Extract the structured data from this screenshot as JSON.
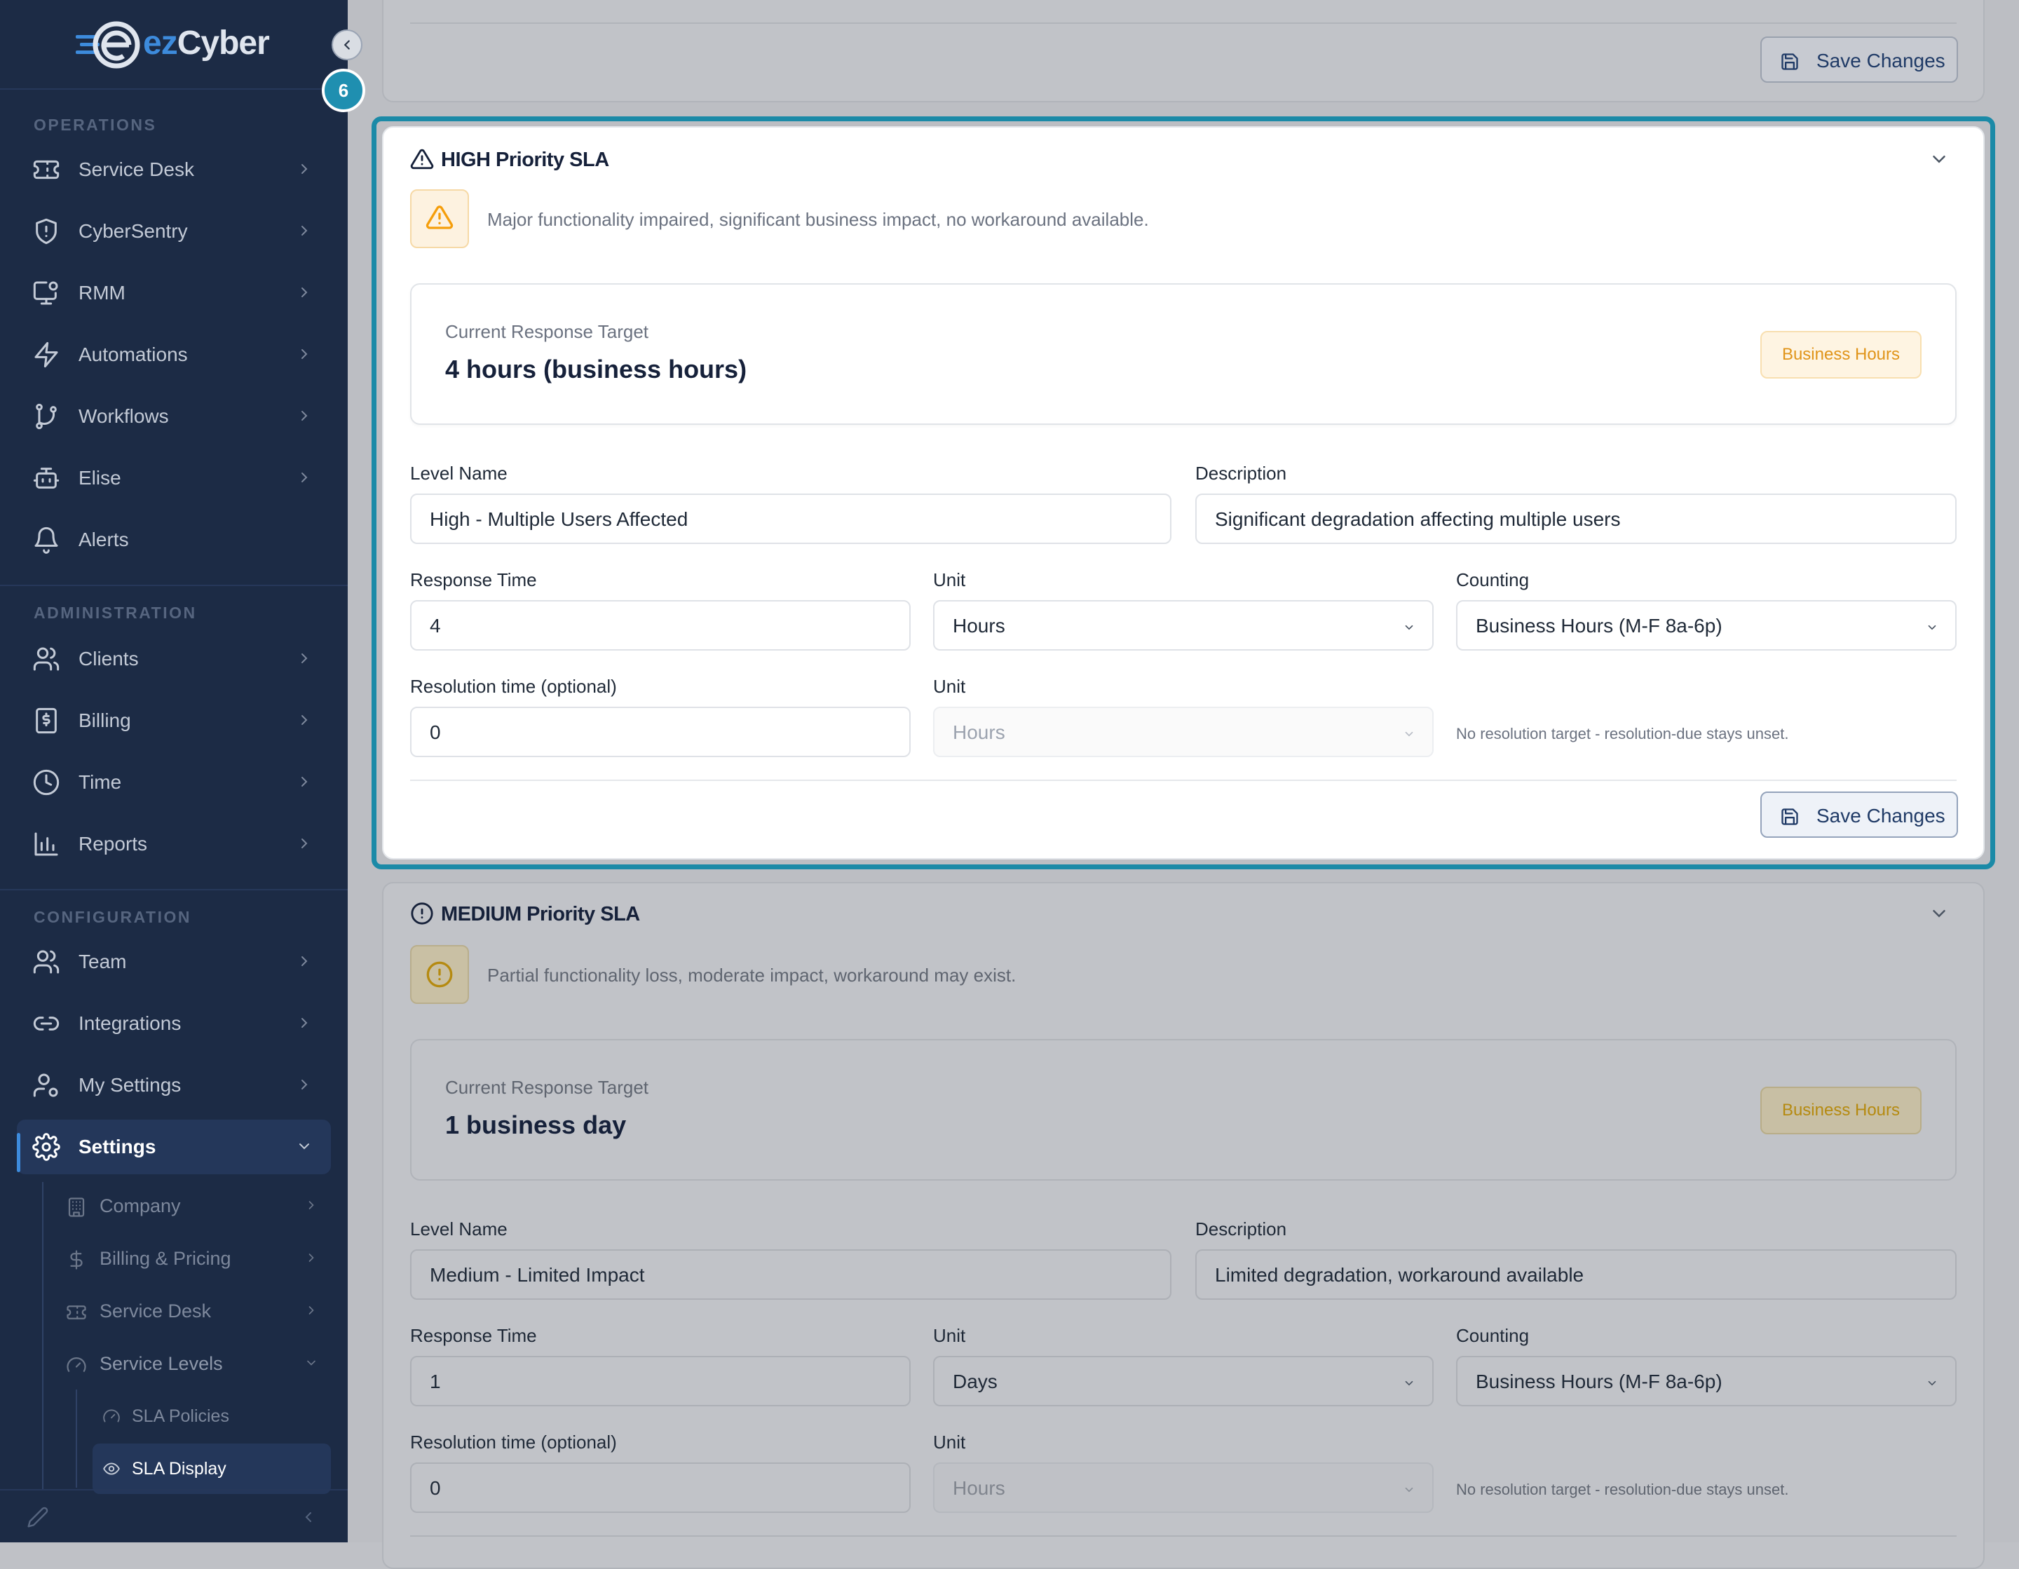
{
  "brand": {
    "prefix": "ez",
    "name": "Cyber"
  },
  "step_badge": "6",
  "sidebar": {
    "sections": [
      {
        "title": "OPERATIONS",
        "items": [
          {
            "label": "Service Desk"
          },
          {
            "label": "CyberSentry"
          },
          {
            "label": "RMM"
          },
          {
            "label": "Automations"
          },
          {
            "label": "Workflows"
          },
          {
            "label": "Elise"
          },
          {
            "label": "Alerts"
          }
        ]
      },
      {
        "title": "ADMINISTRATION",
        "items": [
          {
            "label": "Clients"
          },
          {
            "label": "Billing"
          },
          {
            "label": "Time"
          },
          {
            "label": "Reports"
          }
        ]
      },
      {
        "title": "CONFIGURATION",
        "items": [
          {
            "label": "Team"
          },
          {
            "label": "Integrations"
          },
          {
            "label": "My Settings"
          },
          {
            "label": "Settings"
          }
        ]
      }
    ],
    "settings_children": [
      {
        "label": "Company"
      },
      {
        "label": "Billing & Pricing"
      },
      {
        "label": "Service Desk"
      },
      {
        "label": "Service Levels"
      }
    ],
    "service_levels_children": [
      {
        "label": "SLA Policies"
      },
      {
        "label": "SLA Display"
      }
    ]
  },
  "colors": {
    "accent": "#1b8aa7",
    "sidebar_bg": "#1c2b45",
    "high_warn": "#f59e0b",
    "medium_warn": "#d4a017"
  },
  "top_card": {
    "save_label": "Save Changes"
  },
  "high_sla": {
    "title": "HIGH Priority SLA",
    "description": "Major functionality impaired, significant business impact, no workaround available.",
    "target_label": "Current Response Target",
    "target_value": "4 hours (business hours)",
    "badge": "Business Hours",
    "level_name_label": "Level Name",
    "level_name": "High - Multiple Users Affected",
    "description_label": "Description",
    "description_value": "Significant degradation affecting multiple users",
    "response_time_label": "Response Time",
    "response_time": "4",
    "unit_label": "Unit",
    "unit": "Hours",
    "counting_label": "Counting",
    "counting": "Business Hours (M-F 8a-6p)",
    "resolution_label": "Resolution time (optional)",
    "resolution": "0",
    "resolution_unit_label": "Unit",
    "resolution_unit": "Hours",
    "hint": "No resolution target - resolution-due stays unset.",
    "save_label": "Save Changes"
  },
  "medium_sla": {
    "title": "MEDIUM Priority SLA",
    "description": "Partial functionality loss, moderate impact, workaround may exist.",
    "target_label": "Current Response Target",
    "target_value": "1 business day",
    "badge": "Business Hours",
    "level_name_label": "Level Name",
    "level_name": "Medium - Limited Impact",
    "description_label": "Description",
    "description_value": "Limited degradation, workaround available",
    "response_time_label": "Response Time",
    "response_time": "1",
    "unit_label": "Unit",
    "unit": "Days",
    "counting_label": "Counting",
    "counting": "Business Hours (M-F 8a-6p)",
    "resolution_label": "Resolution time (optional)",
    "resolution": "0",
    "resolution_unit_label": "Unit",
    "resolution_unit": "Hours",
    "hint": "No resolution target - resolution-due stays unset."
  }
}
